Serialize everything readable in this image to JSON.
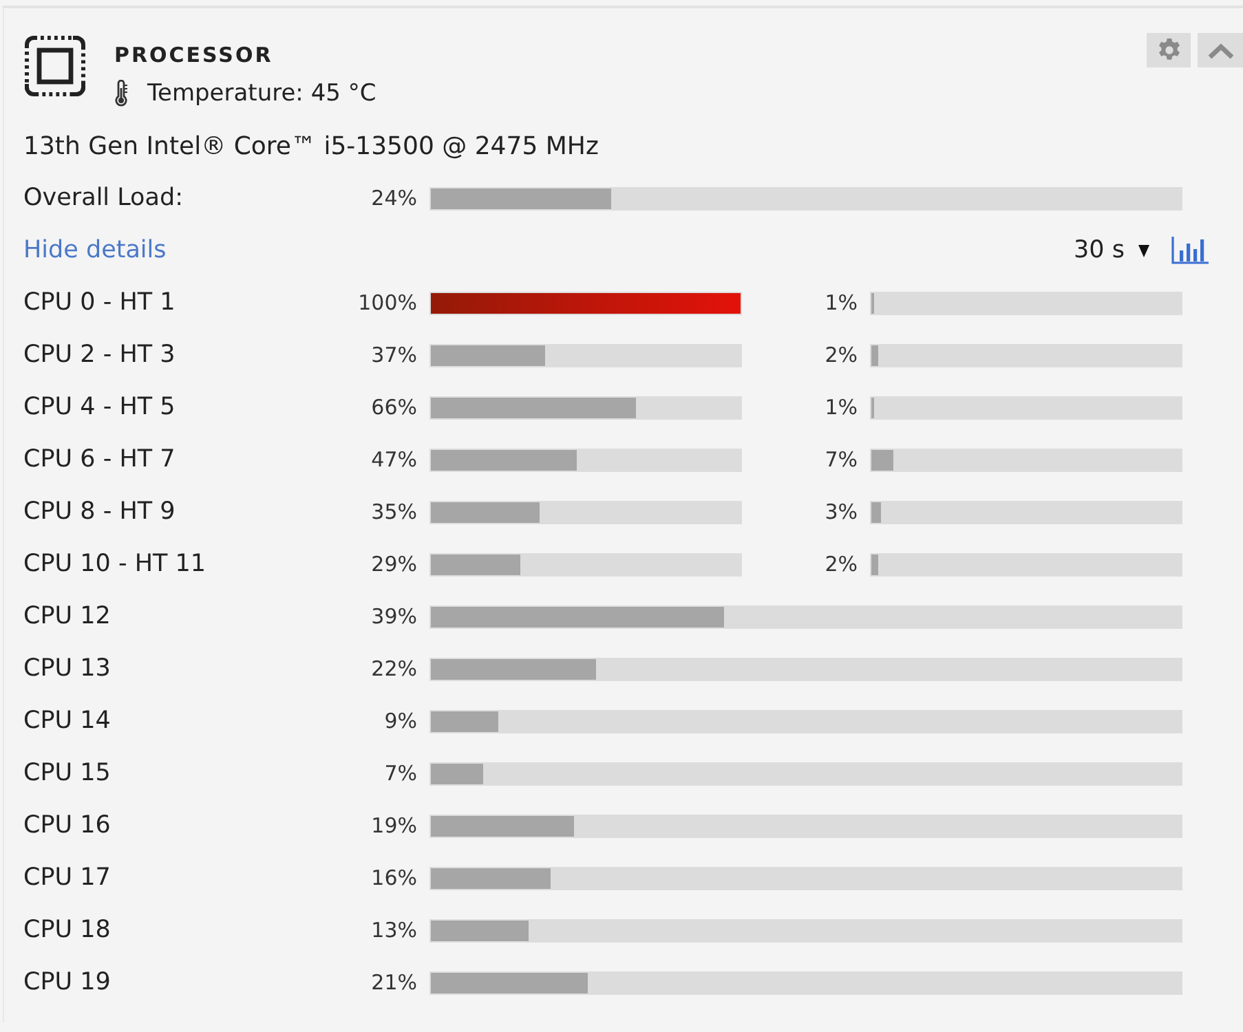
{
  "header": {
    "title": "PROCESSOR",
    "temperature": "Temperature: 45 °C"
  },
  "model": "13th Gen Intel® Core™ i5-13500 @ 2475 MHz",
  "overall": {
    "label": "Overall Load:",
    "reading": "24%",
    "level": 0.24
  },
  "details_link": "Hide details",
  "interval": {
    "value": "30 s"
  },
  "cores": [
    {
      "label": "CPU 0 - HT 1",
      "meters": [
        {
          "reading": "100%",
          "level": 1.0
        },
        {
          "reading": "1%",
          "level": 0.01
        }
      ]
    },
    {
      "label": "CPU 2 - HT 3",
      "meters": [
        {
          "reading": "37%",
          "level": 0.37
        },
        {
          "reading": "2%",
          "level": 0.02
        }
      ]
    },
    {
      "label": "CPU 4 - HT 5",
      "meters": [
        {
          "reading": "66%",
          "level": 0.66
        },
        {
          "reading": "1%",
          "level": 0.01
        }
      ]
    },
    {
      "label": "CPU 6 - HT 7",
      "meters": [
        {
          "reading": "47%",
          "level": 0.47
        },
        {
          "reading": "7%",
          "level": 0.07
        }
      ]
    },
    {
      "label": "CPU 8 - HT 9",
      "meters": [
        {
          "reading": "35%",
          "level": 0.35
        },
        {
          "reading": "3%",
          "level": 0.03
        }
      ]
    },
    {
      "label": "CPU 10 - HT 11",
      "meters": [
        {
          "reading": "29%",
          "level": 0.29
        },
        {
          "reading": "2%",
          "level": 0.02
        }
      ]
    },
    {
      "label": "CPU 12",
      "meters": [
        {
          "reading": "39%",
          "level": 0.39
        }
      ]
    },
    {
      "label": "CPU 13",
      "meters": [
        {
          "reading": "22%",
          "level": 0.22
        }
      ]
    },
    {
      "label": "CPU 14",
      "meters": [
        {
          "reading": "9%",
          "level": 0.09
        }
      ]
    },
    {
      "label": "CPU 15",
      "meters": [
        {
          "reading": "7%",
          "level": 0.07
        }
      ]
    },
    {
      "label": "CPU 16",
      "meters": [
        {
          "reading": "19%",
          "level": 0.19
        }
      ]
    },
    {
      "label": "CPU 17",
      "meters": [
        {
          "reading": "16%",
          "level": 0.16
        }
      ]
    },
    {
      "label": "CPU 18",
      "meters": [
        {
          "reading": "13%",
          "level": 0.13
        }
      ]
    },
    {
      "label": "CPU 19",
      "meters": [
        {
          "reading": "21%",
          "level": 0.21
        }
      ]
    }
  ]
}
